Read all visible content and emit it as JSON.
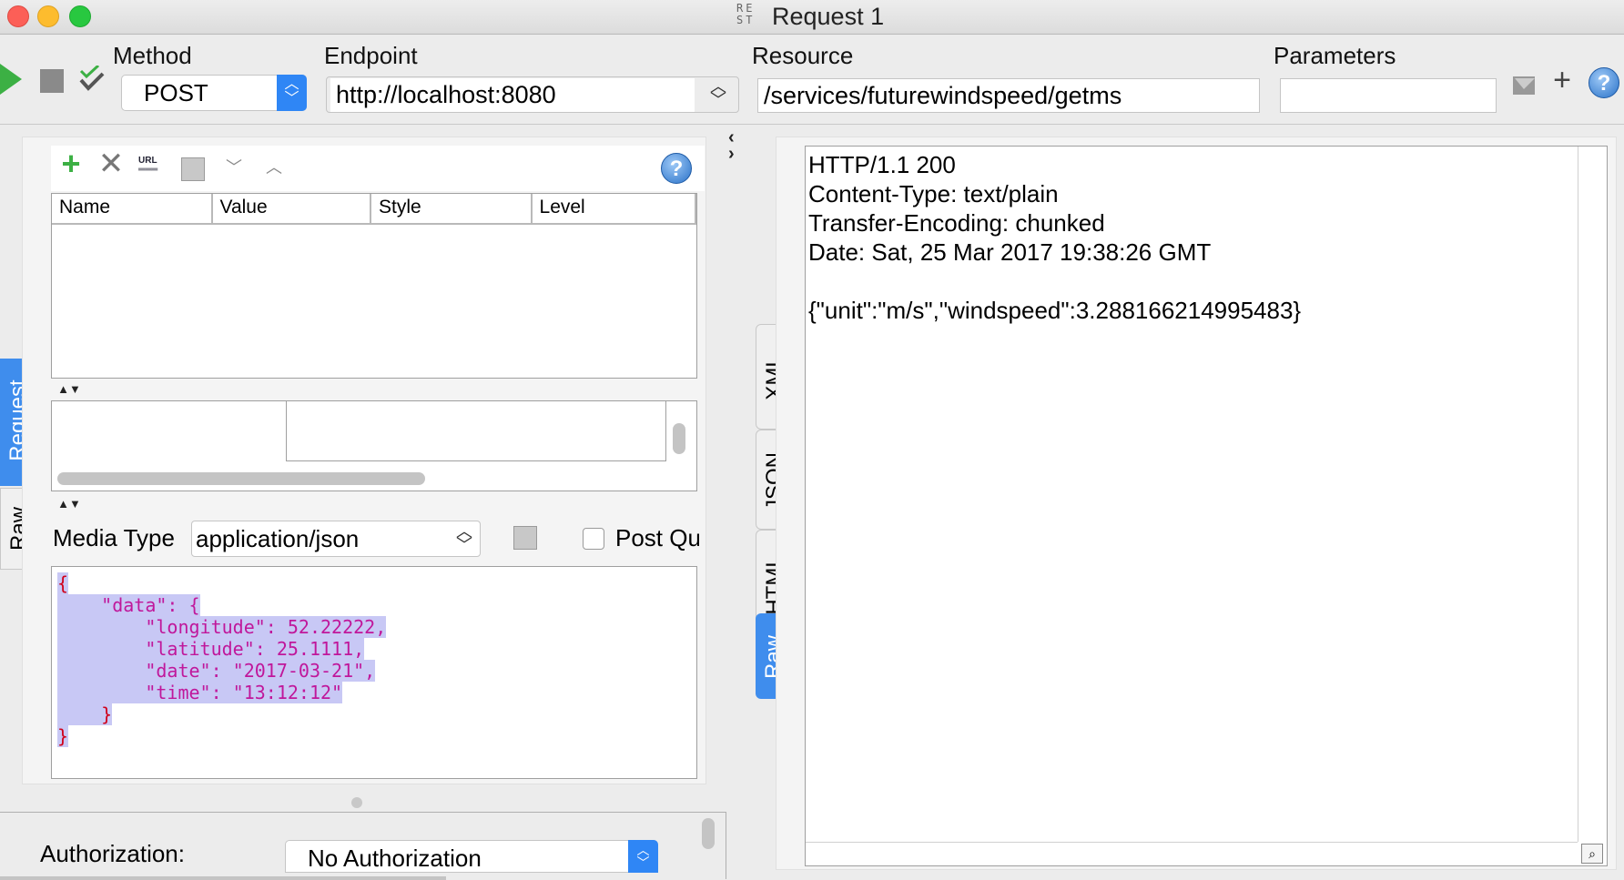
{
  "window": {
    "title": "Request 1",
    "icon_text": "RE ST"
  },
  "toolbar": {
    "method_label": "Method",
    "method_value": "POST",
    "endpoint_label": "Endpoint",
    "endpoint_value": "http://localhost:8080",
    "resource_label": "Resource",
    "resource_value": "/services/futurewindspeed/getms",
    "parameters_label": "Parameters",
    "parameters_value": ""
  },
  "params_table": {
    "columns": [
      "Name",
      "Value",
      "Style",
      "Level"
    ]
  },
  "request": {
    "media_type_label": "Media Type",
    "media_type_value": "application/json",
    "post_query_label": "Post Qu",
    "body_lines": [
      "{",
      "    \"data\": {",
      "        \"longitude\": 52.22222,",
      "        \"latitude\": 25.1111,",
      "        \"date\": \"2017-03-21\",",
      "        \"time\": \"13:12:12\"",
      "    }",
      "}"
    ],
    "authorization_label": "Authorization:",
    "authorization_value": "No Authorization"
  },
  "left_tabs": [
    "Request",
    "Raw"
  ],
  "response_tabs": [
    "XML",
    "JSON",
    "HTML",
    "Raw"
  ],
  "response_lines": [
    "HTTP/1.1 200",
    "Content-Type: text/plain",
    "Transfer-Encoding: chunked",
    "Date: Sat, 25 Mar 2017 19:38:26 GMT",
    "",
    "{\"unit\":\"m/s\",\"windspeed\":3.288166214995483}"
  ],
  "colors": {
    "accent": "#4a90e2",
    "play": "#3cb044",
    "json_key": "#c0179b",
    "brace": "#d0021b",
    "selection": "#c8c8f5"
  },
  "icons": [
    "play-icon",
    "stop-icon",
    "validate-icon",
    "add-icon",
    "delete-icon",
    "url-icon",
    "refresh-icon",
    "move-down-icon",
    "move-up-icon",
    "help-icon",
    "plus-icon",
    "config-icon",
    "find-icon"
  ]
}
